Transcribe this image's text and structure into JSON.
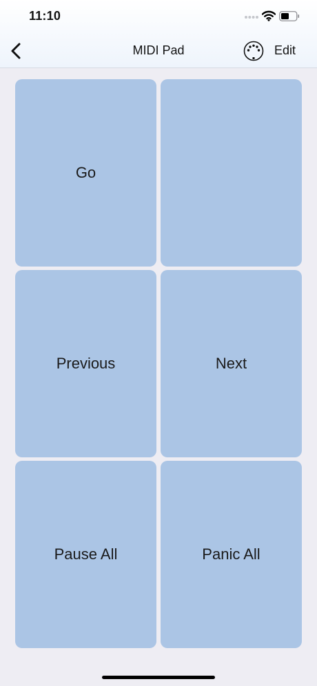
{
  "status_bar": {
    "time": "11:10"
  },
  "nav": {
    "title": "MIDI Pad",
    "edit_label": "Edit"
  },
  "icons": {
    "back": "chevron-left-icon",
    "midi": "midi-din-connector-icon",
    "wifi": "wifi-icon",
    "battery": "battery-icon"
  },
  "pads": [
    {
      "label": "Go"
    },
    {
      "label": ""
    },
    {
      "label": "Previous"
    },
    {
      "label": "Next"
    },
    {
      "label": "Pause All"
    },
    {
      "label": "Panic All"
    }
  ],
  "colors": {
    "pad": "#abc5e5",
    "background": "#eeedf3"
  }
}
